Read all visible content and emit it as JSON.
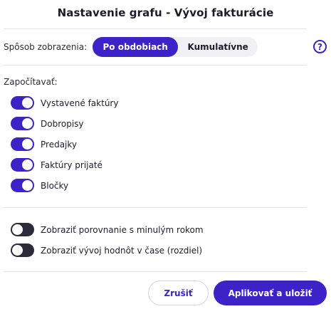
{
  "dialog": {
    "title": "Nastavenie grafu - Vývoj fakturácie"
  },
  "view": {
    "label": "Spôsob zobrazenia:",
    "options": [
      {
        "label": "Po obdobiach",
        "selected": true
      },
      {
        "label": "Kumulatívne",
        "selected": false
      }
    ],
    "help_glyph": "?"
  },
  "include": {
    "label": "Započítavať:",
    "items": [
      {
        "label": "Vystavené faktúry",
        "on": true
      },
      {
        "label": "Dobropisy",
        "on": true
      },
      {
        "label": "Predajky",
        "on": true
      },
      {
        "label": "Faktúry prijaté",
        "on": true
      },
      {
        "label": "Bločky",
        "on": true
      }
    ]
  },
  "extra": {
    "items": [
      {
        "label": "Zobraziť porovnanie s minulým rokom",
        "on": false
      },
      {
        "label": "Zobraziť vývoj hodnôt v čase (rozdiel)",
        "on": false
      }
    ]
  },
  "footer": {
    "cancel_label": "Zrušiť",
    "apply_label": "Aplikovať a uložiť"
  },
  "colors": {
    "accent": "#3d22c7",
    "toggle_off": "#2b2b3a",
    "divider": "#e3e3ea"
  },
  "icons": {
    "help": "help-icon"
  }
}
